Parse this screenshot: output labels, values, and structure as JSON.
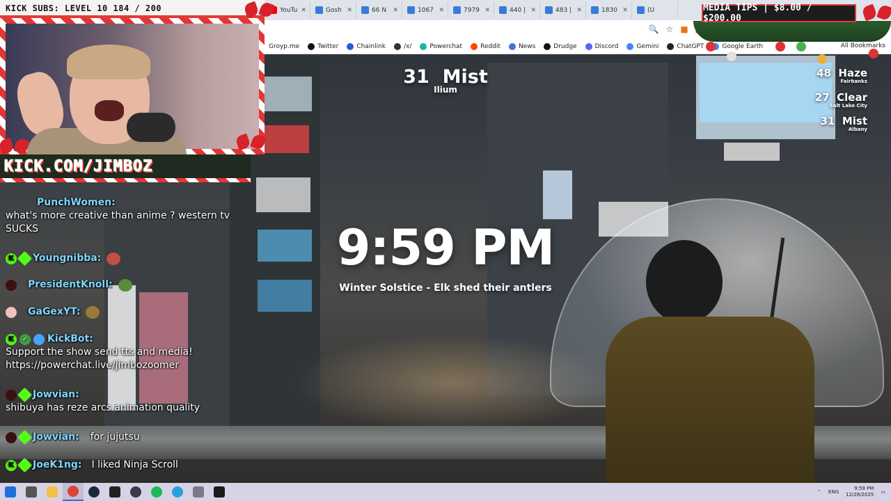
{
  "overlay": {
    "subs_text": "KICK SUBS: LEVEL 10 184 / 200",
    "kick_url": "KICK.COM/JIMBOZ",
    "media_tips": "MEDIA TIPS | $8.00 / $200.00"
  },
  "browser": {
    "tabs": [
      {
        "label": "YouTu",
        "color": "#ff0000"
      },
      {
        "label": "Gosh",
        "color": "#3b7bd8"
      },
      {
        "label": "66 N",
        "color": "#3b7bd8"
      },
      {
        "label": "1067",
        "color": "#3b7bd8"
      },
      {
        "label": "7979",
        "color": "#3b7bd8"
      },
      {
        "label": "440 |",
        "color": "#3b7bd8"
      },
      {
        "label": "483 |",
        "color": "#3b7bd8"
      },
      {
        "label": "1830",
        "color": "#3b7bd8"
      },
      {
        "label": "(U",
        "color": "#3b7bd8"
      }
    ],
    "bookmarks": [
      {
        "label": "Groyp.me",
        "color": "#ffffff"
      },
      {
        "label": "Twitter",
        "color": "#111111"
      },
      {
        "label": "Chainlink",
        "color": "#2a5ada"
      },
      {
        "label": "/x/",
        "color": "#333333"
      },
      {
        "label": "Powerchat",
        "color": "#17b6a0"
      },
      {
        "label": "Reddit",
        "color": "#ff4500"
      },
      {
        "label": "News",
        "color": "#4a6fd8"
      },
      {
        "label": "Drudge",
        "color": "#111111"
      },
      {
        "label": "Discord",
        "color": "#5865f2"
      },
      {
        "label": "Gemini",
        "color": "#4285f4"
      },
      {
        "label": "ChatGPT",
        "color": "#222222"
      },
      {
        "label": "Google Earth",
        "color": "#4285f4"
      }
    ],
    "all_bookmarks": "All Bookmarks"
  },
  "weather": {
    "main": {
      "temp": "31",
      "cond": "Mist",
      "location": "Ilium"
    },
    "side": [
      {
        "temp": "48",
        "cond": "Haze",
        "location": "Fairbanks"
      },
      {
        "temp": "27",
        "cond": "Clear",
        "location": "Salt Lake City"
      },
      {
        "temp": "31",
        "cond": "Mist",
        "location": "Albany"
      }
    ]
  },
  "clock": {
    "time": "9:59 PM",
    "subtitle": "Winter Solstice - Elk shed their antlers"
  },
  "chat": [
    {
      "user": "PunchWomen:",
      "text": "what's more creative than anime ? western tv SUCKS",
      "badges": [],
      "emote": false
    },
    {
      "user": "Youngnibba:",
      "text": "",
      "badges": [
        "kick",
        "gem"
      ],
      "emote": true
    },
    {
      "user": "PresidentKnoll:",
      "text": "",
      "badges": [
        "dark"
      ],
      "emote": true
    },
    {
      "user": "GaGexYT:",
      "text": "",
      "badges": [
        "pig"
      ],
      "emote": true
    },
    {
      "user": "KickBot:",
      "text": "Support the show send tts and media! https://powerchat.live/jimbozoomer",
      "badges": [
        "kick",
        "verify",
        "sub"
      ],
      "emote": false
    },
    {
      "user": "Jowvian:",
      "text": "shibuya has reze arcs animation quality",
      "badges": [
        "dark",
        "gem"
      ],
      "emote": false
    },
    {
      "user": "Jowvian:",
      "text": "for jujutsu",
      "badges": [
        "dark",
        "gem"
      ],
      "emote": false,
      "inline": true
    },
    {
      "user": "JoeK1ng:",
      "text": "I liked Ninja Scroll",
      "badges": [
        "kick",
        "gem"
      ],
      "emote": false,
      "inline": true
    }
  ],
  "taskbar": {
    "apps": [
      {
        "name": "windows-start-icon",
        "color": "#1e6fd9"
      },
      {
        "name": "task-view-icon",
        "color": "#555555"
      },
      {
        "name": "file-explorer-icon",
        "color": "#f2c04b"
      },
      {
        "name": "chrome-icon",
        "color": "#db4437"
      },
      {
        "name": "steam-icon",
        "color": "#1b2838"
      },
      {
        "name": "terminal-icon",
        "color": "#222222"
      },
      {
        "name": "obs-icon",
        "color": "#3a3a4a"
      },
      {
        "name": "spotify-icon",
        "color": "#1db954"
      },
      {
        "name": "telegram-icon",
        "color": "#2aa1da"
      },
      {
        "name": "media-icon",
        "color": "#7a7a8a"
      },
      {
        "name": "adobe-icon",
        "color": "#1a1a1a"
      }
    ],
    "lang": "ENG",
    "time": "9:59 PM",
    "date": "12/28/2025"
  }
}
